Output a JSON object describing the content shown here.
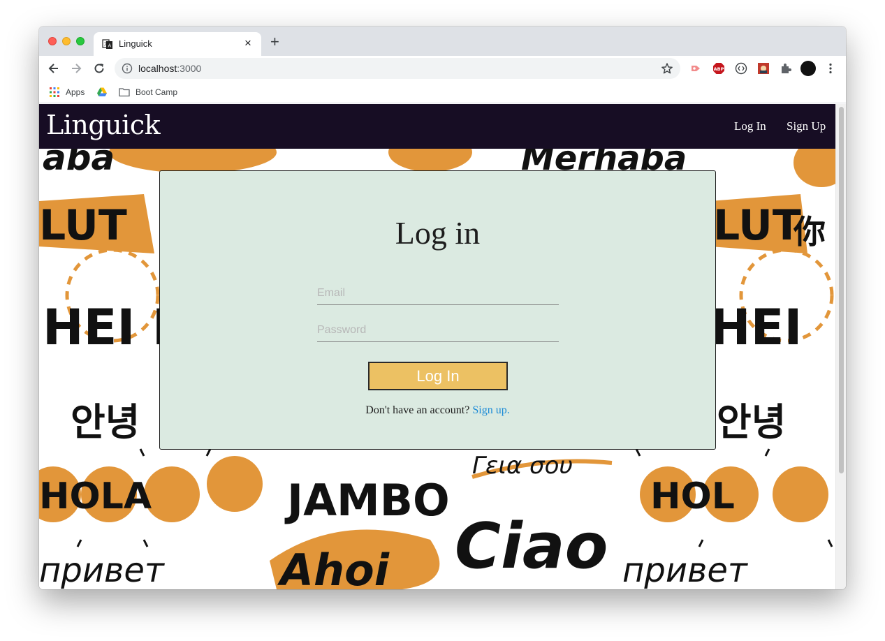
{
  "browser": {
    "tab": {
      "title": "Linguick",
      "close": "×"
    },
    "new_tab": "+",
    "url": {
      "host": "localhost",
      "port": ":3000"
    },
    "bookmarks": [
      {
        "label": "Apps",
        "icon": "apps-grid-icon"
      },
      {
        "label": "",
        "icon": "google-drive-icon"
      },
      {
        "label": "Boot Camp",
        "icon": "folder-icon"
      }
    ],
    "extensions": [
      "extension-arrow-icon",
      "adblock-icon",
      "code-extension-icon",
      "image-extension-icon",
      "puzzle-icon",
      "profile-avatar",
      "more-menu-icon"
    ]
  },
  "navbar": {
    "brand": "Linguick",
    "links": {
      "login": "Log In",
      "signup": "Sign Up"
    }
  },
  "login_card": {
    "title": "Log in",
    "email_placeholder": "Email",
    "password_placeholder": "Password",
    "submit_label": "Log In",
    "signup_prompt": "Don't have an account?",
    "signup_link": "Sign up."
  },
  "background_words": [
    "aba",
    "LUT",
    "HEI HE",
    "HOLA",
    "JAMBO",
    "Ahoi",
    "Ciao",
    "Γεια σου",
    "Merhaba",
    "안녕",
    "HEI",
    "HOL",
    "привет",
    "你"
  ],
  "colors": {
    "navbar": "#170d24",
    "card": "#dbeae1",
    "button": "#ecc163",
    "link": "#1a8ad6",
    "accent_orange": "#e2963a"
  }
}
